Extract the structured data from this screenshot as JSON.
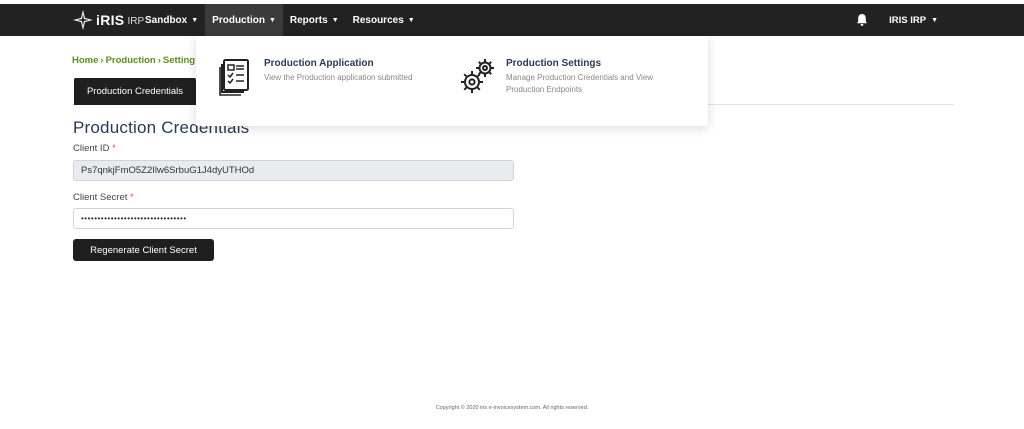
{
  "brand": {
    "name": "iRIS",
    "suffix": "IRP"
  },
  "nav": {
    "items": [
      {
        "label": "Sandbox",
        "active": false
      },
      {
        "label": "Production",
        "active": true
      },
      {
        "label": "Reports",
        "active": false
      },
      {
        "label": "Resources",
        "active": false
      }
    ],
    "user": "IRIS IRP",
    "bell_icon": "bell-icon"
  },
  "breadcrumb": [
    "Home",
    "Production",
    "Setting"
  ],
  "tab": {
    "label": "Production Credentials"
  },
  "form": {
    "title": "Production Credentials",
    "client_id": {
      "label": "Client ID",
      "required_mark": "*",
      "value": "Ps7qnkjFmO5Z2Ilw6SrbuG1J4dyUTHOd"
    },
    "client_secret": {
      "label": "Client Secret",
      "required_mark": "*",
      "value": "••••••••••••••••••••••••••••••••"
    },
    "regenerate_label": "Regenerate Client Secret"
  },
  "mega_menu": {
    "items": [
      {
        "title": "Production Application",
        "desc": "View the Production application submitted",
        "icon": "application-document-icon"
      },
      {
        "title": "Production Settings",
        "desc": "Manage Production Credentials and View Production Endpoints",
        "icon": "settings-gears-icon"
      }
    ]
  },
  "footer": {
    "text": "Copyright © 2020 iris e-invoicesystem.com. All rights reserved."
  },
  "colors": {
    "navbar": "#222222",
    "breadcrumb": "#5a8f1d",
    "title": "#2b3a55",
    "button": "#1f1f1f",
    "required": "#d9534f"
  }
}
